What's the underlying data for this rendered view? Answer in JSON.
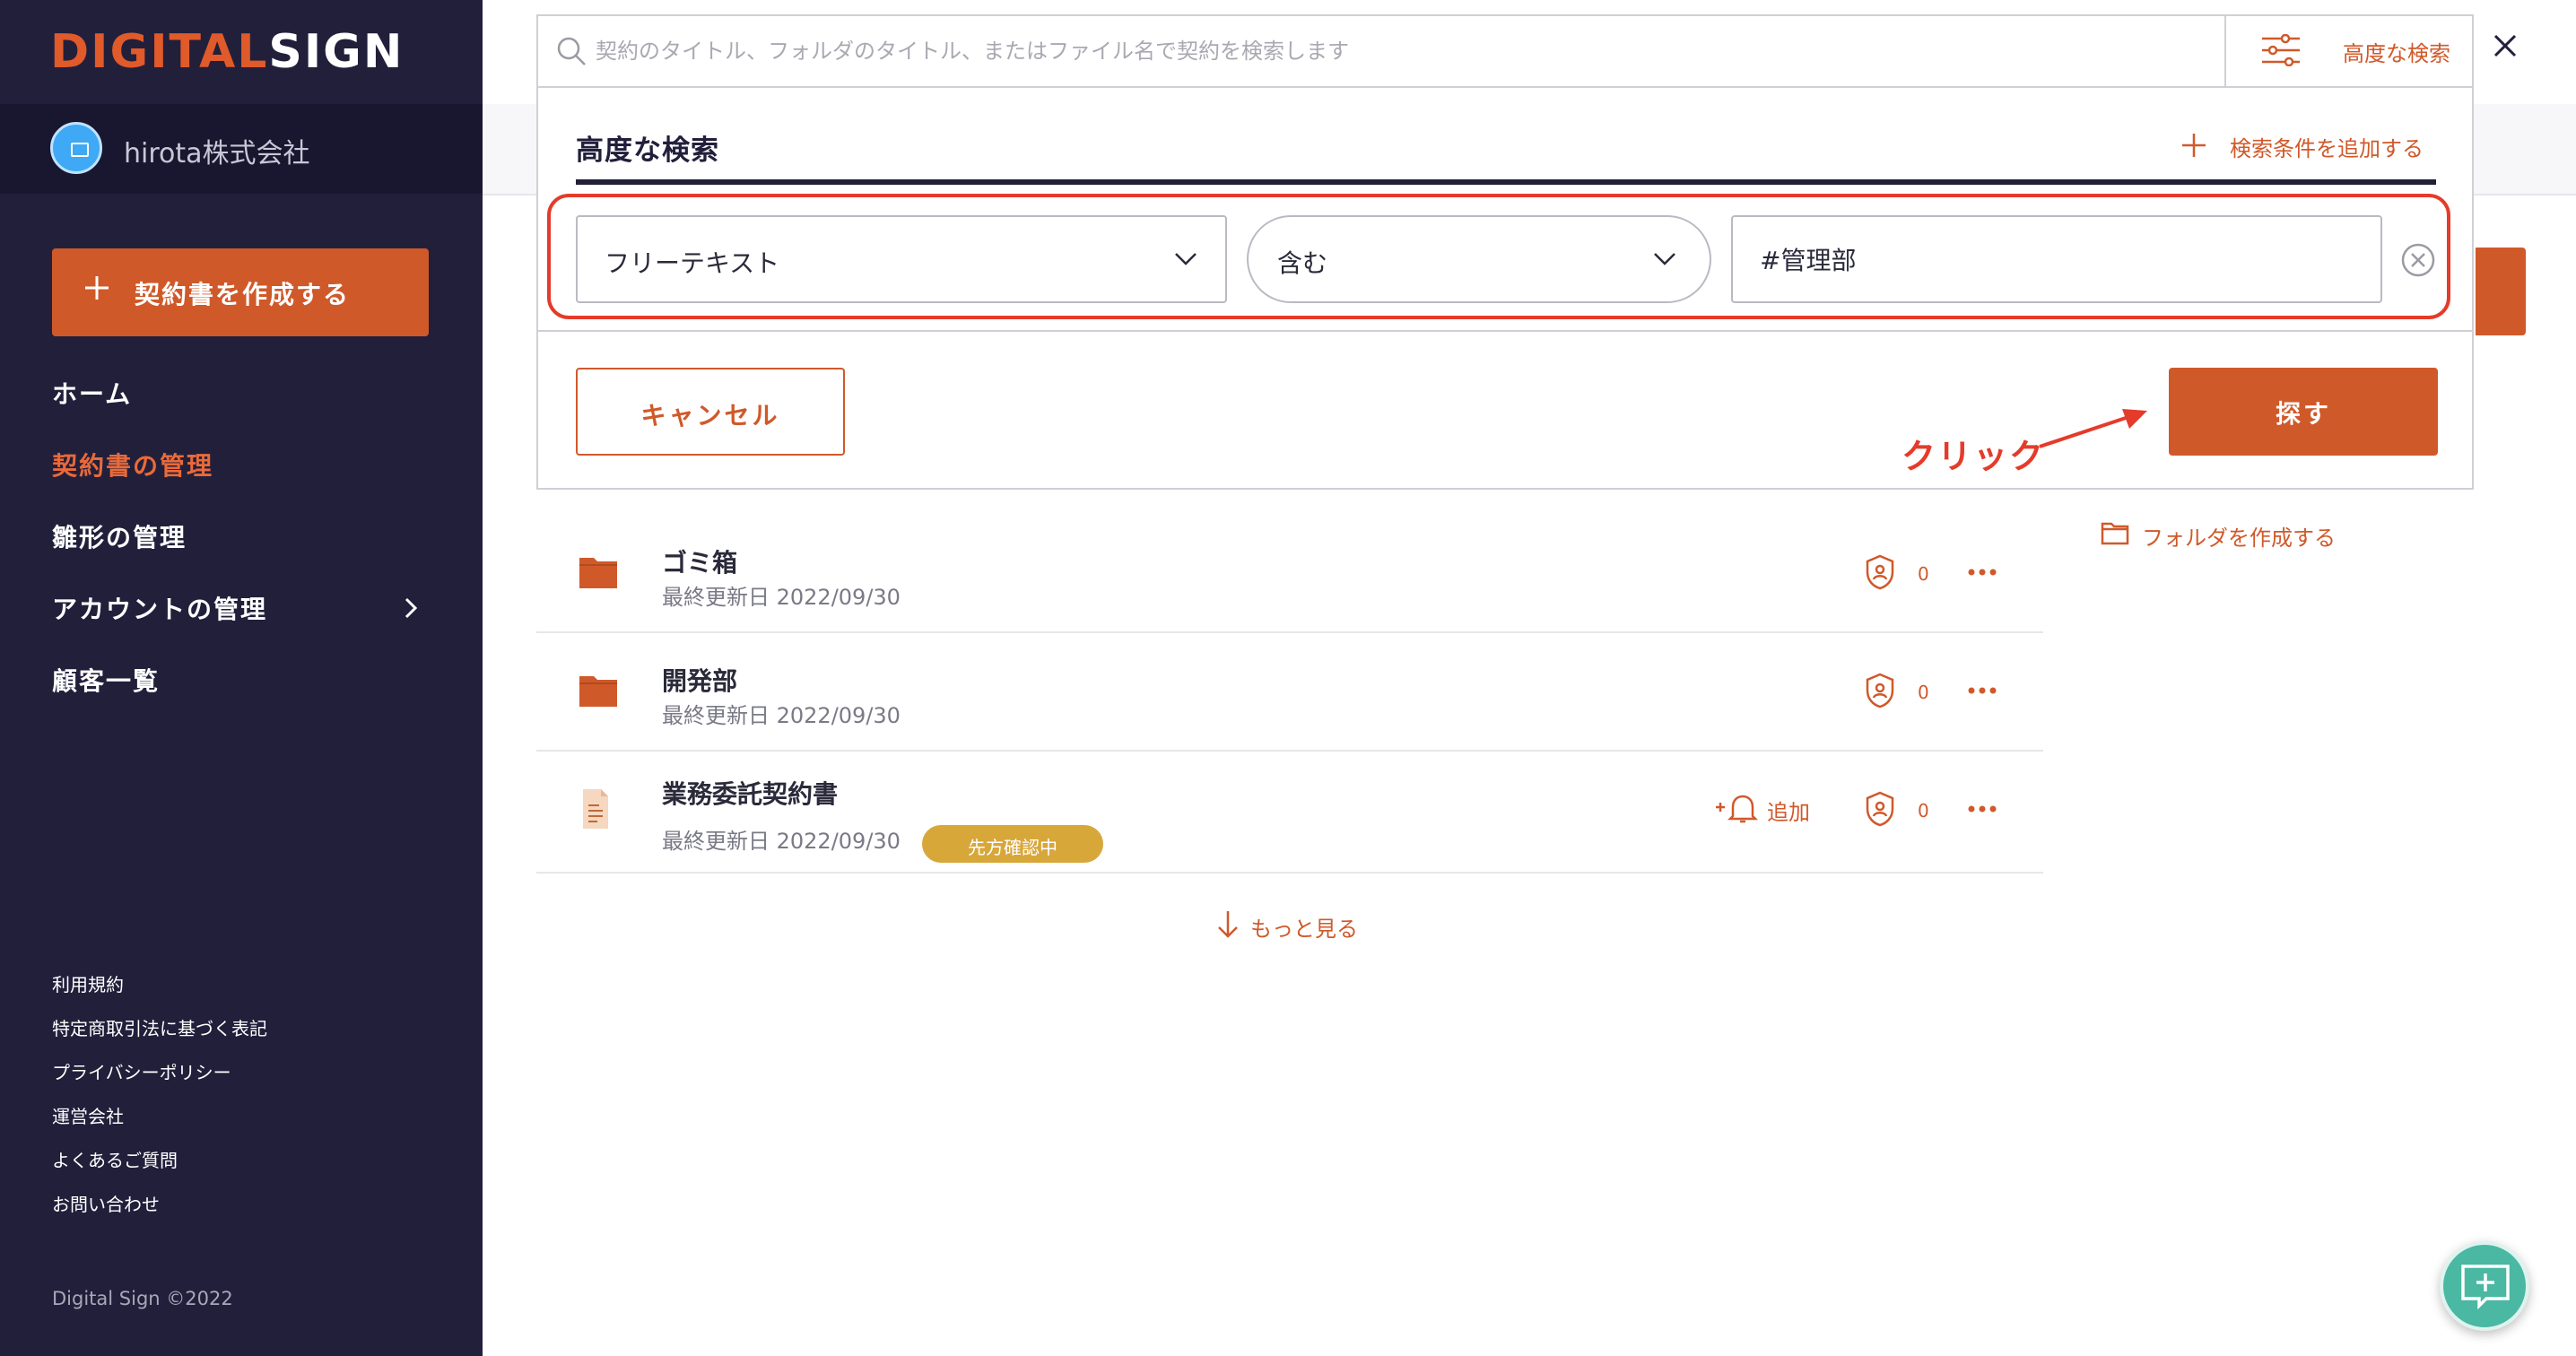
{
  "brand": {
    "logo_text_a": "DIGIT",
    "logo_text_b": "AL",
    "logo_text_c": "SIGN",
    "accent": "#d0592a",
    "sidebar_bg": "#221f3b"
  },
  "sidebar": {
    "company_name": "hirota株式会社",
    "create_label": "契約書を作成する",
    "nav": [
      {
        "label": "ホーム",
        "active": false
      },
      {
        "label": "契約書の管理",
        "active": true
      },
      {
        "label": "雛形の管理",
        "active": false
      },
      {
        "label": "アカウントの管理",
        "active": false,
        "has_chevron": true
      },
      {
        "label": "顧客一覧",
        "active": false
      }
    ],
    "footer_links": [
      "利用規約",
      "特定商取引法に基づく表記",
      "プライバシーポリシー",
      "運営会社",
      "よくあるご質問",
      "お問い合わせ"
    ],
    "copyright": "Digital Sign ©2022"
  },
  "search": {
    "placeholder": "契約のタイトル、フォルダのタイトル、またはファイル名で契約を検索します",
    "advanced_toggle": "高度な検索",
    "advanced_title": "高度な検索",
    "add_condition": "検索条件を追加する",
    "condition": {
      "field": "フリーテキスト",
      "operator": "含む",
      "value": "#管理部"
    },
    "cancel_label": "キャンセル",
    "search_label": "探す",
    "annotation": "クリック"
  },
  "list": {
    "create_folder": "フォルダを作成する",
    "items": [
      {
        "type": "folder",
        "title": "ゴミ箱",
        "date": "最終更新日 2022/09/30",
        "count": "0"
      },
      {
        "type": "folder",
        "title": "開発部",
        "date": "最終更新日 2022/09/30",
        "count": "0"
      },
      {
        "type": "document",
        "title": "業務委託契約書",
        "date": "最終更新日 2022/09/30",
        "count": "0",
        "badge": "先方確認中",
        "bell_label": "追加"
      }
    ],
    "more_label": "もっと見る"
  }
}
